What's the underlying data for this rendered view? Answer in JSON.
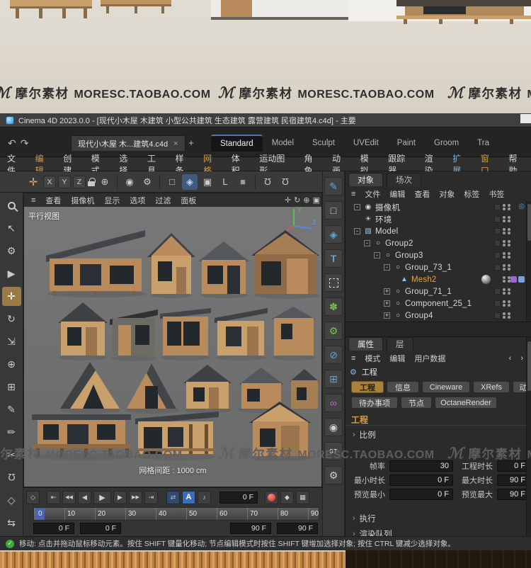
{
  "watermark": {
    "logo": "ℳ",
    "brand": "摩尔素材",
    "site": "MORESC.TAOBAO.COM"
  },
  "titlebar": {
    "title": "Cinema 4D 2023.0.0 - [现代小木屋 木建筑 小型公共建筑 生态建筑 露营建筑 民宿建筑4.c4d] - 主要"
  },
  "tabbar": {
    "document": "现代小木屋 木...建筑4.c4d",
    "close": "×",
    "add": "+",
    "layouts": [
      "Standard",
      "Model",
      "Sculpt",
      "UVEdit",
      "Paint",
      "Groom",
      "Tra"
    ]
  },
  "menubar": [
    "文件",
    "编辑",
    "创建",
    "模式",
    "选择",
    "工具",
    "样条",
    "网格",
    "体积",
    "运动图形",
    "角色",
    "动画",
    "模拟",
    "跟踪器",
    "渲染",
    "扩展",
    "窗口",
    "帮助"
  ],
  "toolbar": {
    "x": "X",
    "y": "Y",
    "z": "Z",
    "axis_l": "L"
  },
  "viewport": {
    "menu": [
      "查看",
      "摄像机",
      "显示",
      "选项",
      "过滤",
      "面板"
    ],
    "view_label": "平行视图",
    "grid_label": "网格间距 : 1000 cm",
    "axis_y": "Y",
    "axis_z": "Z",
    "axis_x": "X"
  },
  "palette": {
    "text_tool": "T",
    "take": "ST"
  },
  "object_manager": {
    "tabs": [
      "对象",
      "场次"
    ],
    "menu": [
      "文件",
      "编辑",
      "查看",
      "对象",
      "标签",
      "书签"
    ],
    "items": [
      {
        "name": "摄像机",
        "toggle": "-"
      },
      {
        "name": "环境"
      },
      {
        "name": "Model",
        "toggle": "-"
      },
      {
        "name": "Group2",
        "toggle": "-"
      },
      {
        "name": "Group3",
        "toggle": "-"
      },
      {
        "name": "Group_73_1",
        "toggle": "-"
      },
      {
        "name": "Mesh2"
      },
      {
        "name": "Group_71_1",
        "toggle": "+"
      },
      {
        "name": "Component_25_1",
        "toggle": "+"
      },
      {
        "name": "Group4",
        "toggle": "+"
      }
    ]
  },
  "attributes": {
    "tabs": [
      "属性",
      "层"
    ],
    "mode_menu": [
      "模式",
      "编辑",
      "用户数据"
    ],
    "object_label": "工程",
    "buttons_row1": [
      "工程",
      "信息",
      "Cineware",
      "XRefs",
      "动力学"
    ],
    "buttons_row2": [
      "待办事项",
      "节点",
      "OctaneRender"
    ],
    "section": "工程",
    "scale_row": "比例",
    "exec_row": "执行",
    "queue_row": "渲染队列",
    "fields": [
      {
        "label": "帧率",
        "value": "30"
      },
      {
        "label": "工程时长",
        "value": "0 F"
      },
      {
        "label": "最小时长",
        "value": "0 F"
      },
      {
        "label": "最大时长",
        "value": "90 F"
      },
      {
        "label": "预览最小",
        "value": "0 F"
      },
      {
        "label": "预览最大",
        "value": "90 F"
      }
    ]
  },
  "timeline": {
    "frame": "0 F",
    "autokey": "A",
    "ticks": [
      "0",
      "10",
      "20",
      "30",
      "40",
      "50",
      "60",
      "70",
      "80",
      "90"
    ],
    "range": [
      "0 F",
      "0 F",
      "90 F",
      "90 F"
    ]
  },
  "statusbar": {
    "message": "移动: 点击并拖动鼠标移动元素。按住 SHIFT 键量化移动; 节点编辑模式时按住 SHIFT 键增加选择对象; 按住 CTRL 键减少选择对象。"
  },
  "icons": {
    "undo": "↶",
    "redo": "↷",
    "hamburger": "≡",
    "cursor": "↖",
    "gear": "⚙",
    "pointer": "▶",
    "move": "✛",
    "rotate": "↻",
    "scale": "⇲",
    "world": "⊕",
    "render": "◉",
    "cube": "◈",
    "cube_outline": "□",
    "cube_dots": "▣",
    "snap": "Ω",
    "grid": "⊞",
    "pen": "✎",
    "brush": "✏",
    "cut": "✂",
    "diamond": "◇",
    "swap": "⇆",
    "square": "■",
    "volume": "✽",
    "circle_slash": "⊘",
    "square_plus": "⊞",
    "knot": "∞",
    "camera": "◉",
    "tree_camera": "◉",
    "tree_env": "☀",
    "tree_model": "▧",
    "tree_null": "○",
    "tree_mesh": "▲",
    "target": "◎",
    "back": "‹",
    "fwd": "›",
    "chev": "›",
    "start": "⇤",
    "end": "⇥",
    "prev": "◀",
    "next": "▶",
    "play": "▶",
    "rw": "◀◀",
    "ff": "▶▶",
    "loop": "⇄",
    "sound": "♪",
    "key": "◆",
    "keybox": "▦",
    "check": "✓"
  }
}
